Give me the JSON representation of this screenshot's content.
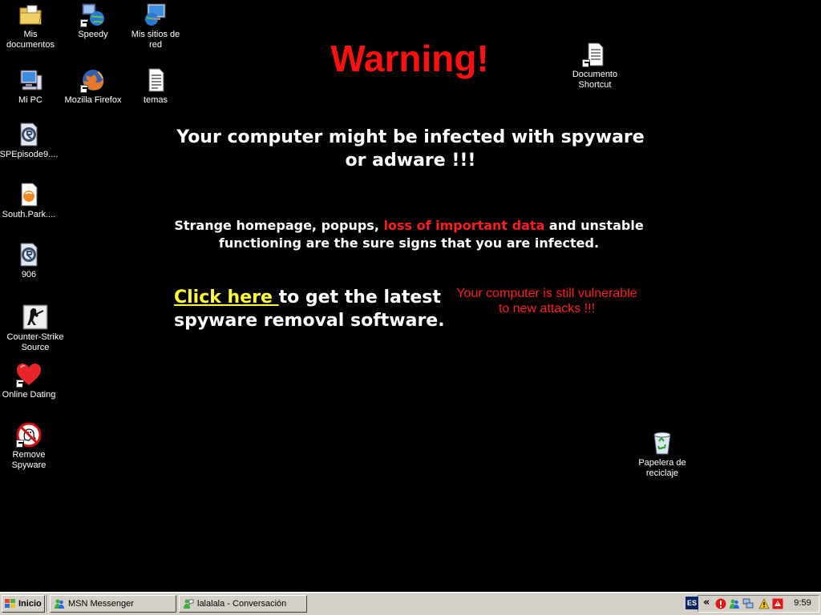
{
  "desktop": {
    "icons": {
      "mis_documentos": "Mis documentos",
      "speedy": "Speedy",
      "mis_sitios": "Mis sitios de red",
      "mi_pc": "Mi PC",
      "firefox": "Mozilla Firefox",
      "temas": "temas",
      "spepisode": "SPEpisode9....",
      "south_park": "South.Park....",
      "n906": "906",
      "counter_strike": "Counter-Strike Source",
      "online_dating": "Online Dating",
      "remove_spyware": "Remove Spyware",
      "documento_shortcut": "Documento Shortcut",
      "papelera": "Papelera de reciclaje"
    }
  },
  "warning": {
    "title": "Warning!",
    "headline": "Your computer might be infected with spyware or adware !!!",
    "signs_before": "Strange homepage, popups, ",
    "signs_red": "loss of important data",
    "signs_after": " and unstable functioning are the sure signs that you are infected.",
    "cta_link": "Click here ",
    "cta_rest": "to get the latest spyware removal software.",
    "vulnerable": "Your computer is still vulnerable to new attacks !!!"
  },
  "taskbar": {
    "start_label": "Inicio",
    "tasks": [
      "MSN Messenger",
      "lalalala - Conversación"
    ],
    "language": "ES",
    "chevron": "«",
    "clock": "9:59"
  },
  "colors": {
    "background": "#000000",
    "warning_red": "#ff1010",
    "link_yellow": "#ffff33",
    "taskbar": "#d4d0c8"
  }
}
